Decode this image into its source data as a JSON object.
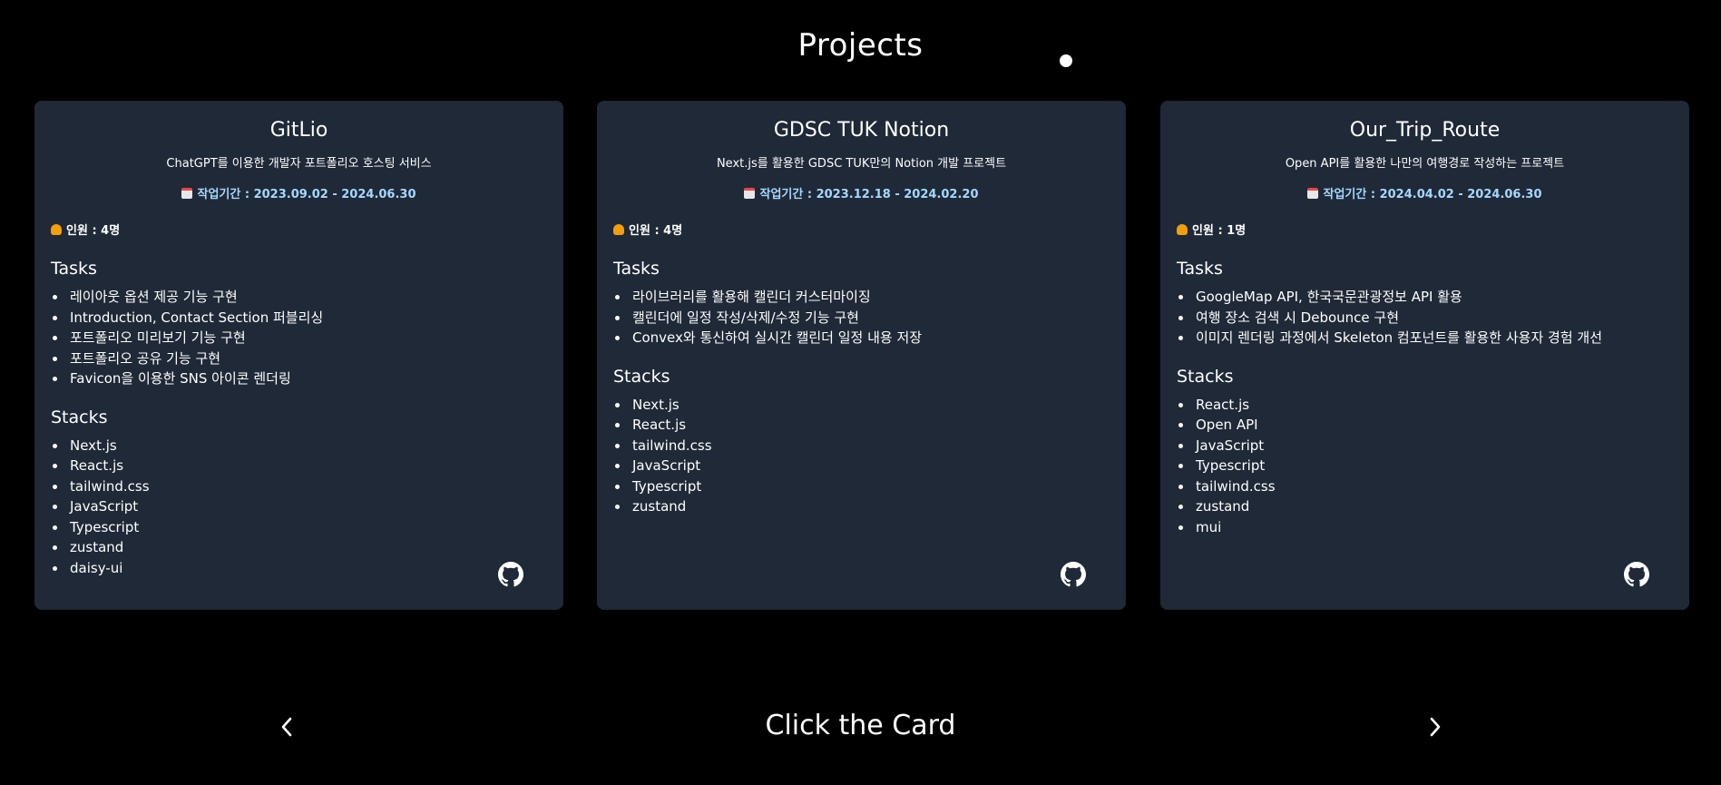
{
  "page": {
    "title": "Projects",
    "hint": "Click the Card"
  },
  "colors": {
    "background": "#000000",
    "card_background": "#1f2937",
    "period_text": "#a5d8ff",
    "text": "#ffffff"
  },
  "icons": {
    "period": "calendar-icon",
    "members": "person-icon",
    "repo_link": "github-icon",
    "prev": "chevron-left-icon",
    "next": "chevron-right-icon"
  },
  "cards": [
    {
      "title": "GitLio",
      "description": "ChatGPT를 이용한 개발자 포트폴리오 호스팅 서비스",
      "period": "작업기간 : 2023.09.02 - 2024.06.30",
      "members": "인원 : 4명",
      "tasks_heading": "Tasks",
      "tasks": [
        "레이아웃 옵션 제공 기능 구현",
        "Introduction, Contact Section 퍼블리싱",
        "포트폴리오 미리보기 기능 구현",
        "포트폴리오 공유 기능 구현",
        "Favicon을 이용한 SNS 아이콘 렌더링"
      ],
      "stacks_heading": "Stacks",
      "stacks": [
        "Next.js",
        "React.js",
        "tailwind.css",
        "JavaScript",
        "Typescript",
        "zustand",
        "daisy-ui"
      ]
    },
    {
      "title": "GDSC TUK Notion",
      "description": "Next.js를 활용한 GDSC TUK만의 Notion 개발 프로젝트",
      "period": "작업기간 : 2023.12.18 - 2024.02.20",
      "members": "인원 : 4명",
      "tasks_heading": "Tasks",
      "tasks": [
        "라이브러리를 활용해 캘린더 커스터마이징",
        "캘린더에 일정 작성/삭제/수정 기능 구현",
        "Convex와 통신하여 실시간 캘린더 일정 내용 저장"
      ],
      "stacks_heading": "Stacks",
      "stacks": [
        "Next.js",
        "React.js",
        "tailwind.css",
        "JavaScript",
        "Typescript",
        "zustand"
      ]
    },
    {
      "title": "Our_Trip_Route",
      "description": "Open API를 활용한 나만의 여행경로 작성하는 프로젝트",
      "period": "작업기간 : 2024.04.02 - 2024.06.30",
      "members": "인원 : 1명",
      "tasks_heading": "Tasks",
      "tasks": [
        "GoogleMap API, 한국국문관광정보 API 활용",
        "여행 장소 검색 시 Debounce 구현",
        "이미지 렌더링 과정에서 Skeleton 컴포넌트를 활용한 사용자 경험 개선"
      ],
      "stacks_heading": "Stacks",
      "stacks": [
        "React.js",
        "Open API",
        "JavaScript",
        "Typescript",
        "tailwind.css",
        "zustand",
        "mui"
      ]
    }
  ]
}
